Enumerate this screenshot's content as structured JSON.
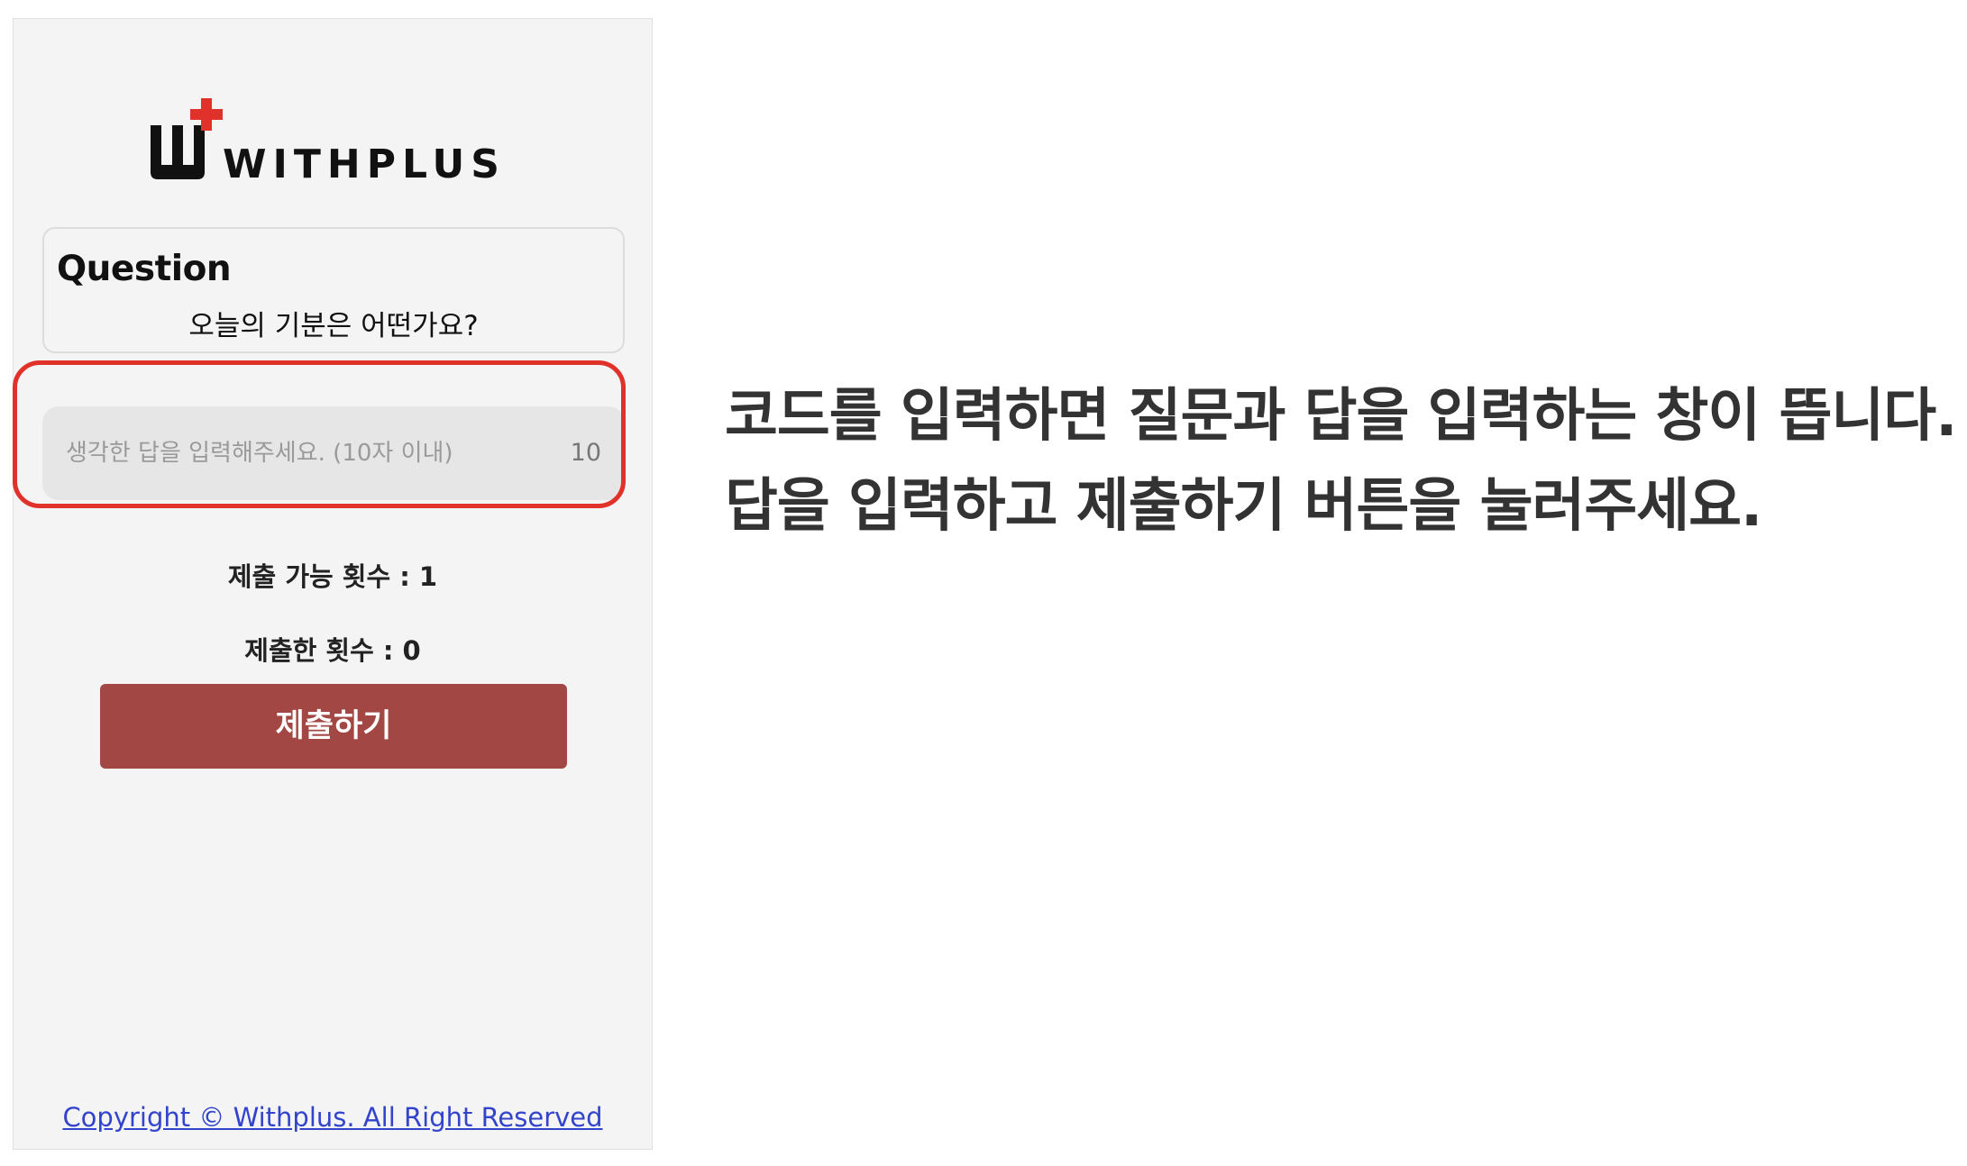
{
  "app": {
    "brand_name": "WITHPLUS",
    "brand_color": "#e0312a",
    "logo_icon": "withplus-logo-icon"
  },
  "question": {
    "title": "Question",
    "text": "오늘의 기분은 어떤가요?"
  },
  "answer_input": {
    "placeholder": "생각한 답을 입력해주세요. (10자 이내)",
    "value": "",
    "remaining_chars": "10"
  },
  "stats": {
    "available_label": "제출 가능 횟수 : 1",
    "submitted_label": "제출한 횟수 : 0"
  },
  "submit_button": {
    "label": "제출하기",
    "color": "#a24743"
  },
  "footer": {
    "copyright": "Copyright © Withplus. All Right Reserved"
  },
  "instruction": {
    "line1": "코드를 입력하면 질문과 답을 입력하는 창이 뜹니다.",
    "line2": "답을 입력하고 제출하기 버튼을 눌러주세요."
  },
  "highlight": {
    "color": "#e0312a"
  }
}
